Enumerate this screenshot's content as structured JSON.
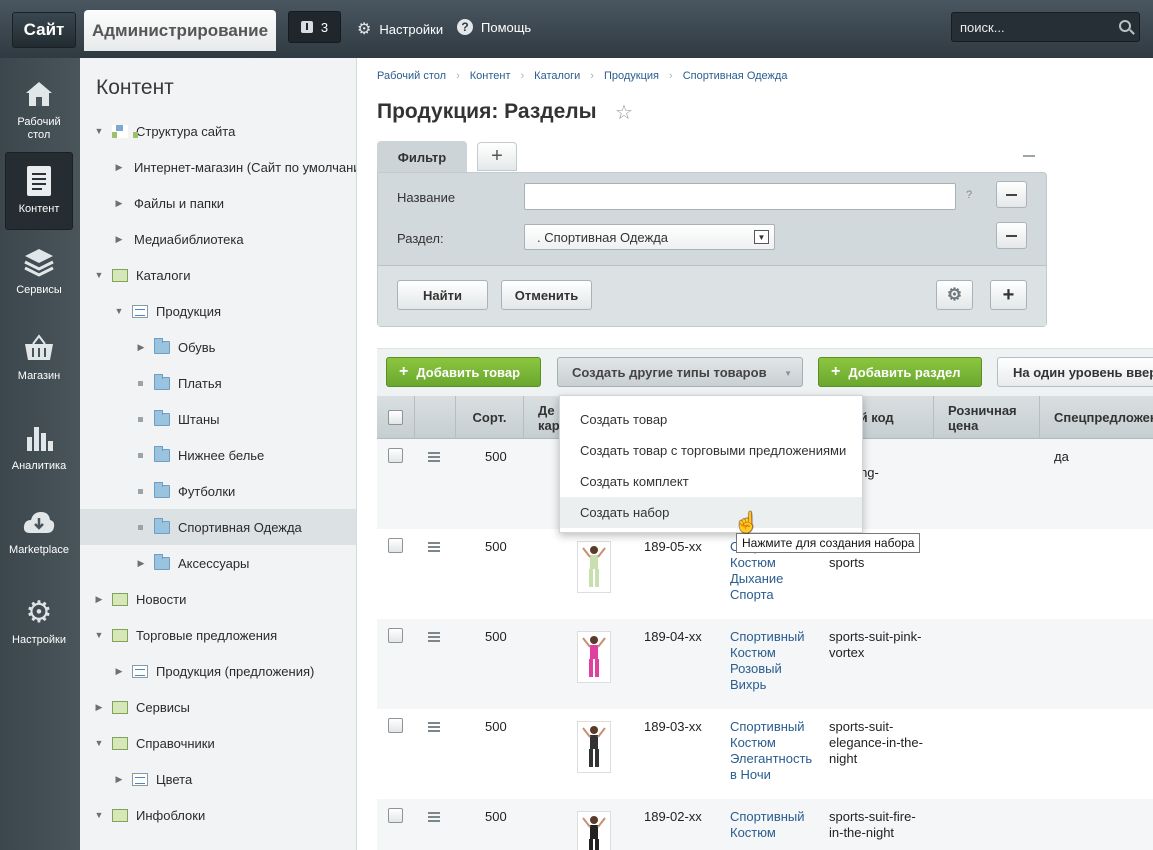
{
  "topbar": {
    "site": "Сайт",
    "admin": "Администрирование",
    "notifications": "3",
    "settings": "Настройки",
    "help": "Помощь",
    "search_placeholder": "поиск..."
  },
  "leftmenu": [
    {
      "label": "Рабочий стол",
      "icon": "home-icon"
    },
    {
      "label": "Контент",
      "icon": "document-icon",
      "active": true
    },
    {
      "label": "Сервисы",
      "icon": "layers-icon"
    },
    {
      "label": "Магазин",
      "icon": "basket-icon"
    },
    {
      "label": "Аналитика",
      "icon": "chart-icon"
    },
    {
      "label": "Marketplace",
      "icon": "cloud-download-icon"
    },
    {
      "label": "Настройки",
      "icon": "gear-icon"
    }
  ],
  "tree": {
    "title": "Контент",
    "items": [
      {
        "label": "Структура сайта",
        "level": 0,
        "expanded": true,
        "icon": "site-structure-icon"
      },
      {
        "label": "Интернет-магазин (Сайт по умолчанию)",
        "level": 1,
        "expanded": false,
        "icon": ""
      },
      {
        "label": "Файлы и папки",
        "level": 1,
        "expanded": false,
        "icon": ""
      },
      {
        "label": "Медиабиблиотека",
        "level": 1,
        "expanded": false,
        "icon": ""
      },
      {
        "label": "Каталоги",
        "level": 0,
        "expanded": true,
        "icon": "catalog-icon"
      },
      {
        "label": "Продукция",
        "level": 1,
        "expanded": true,
        "icon": "list-icon"
      },
      {
        "label": "Обувь",
        "level": 2,
        "expanded": false,
        "icon": "folder-icon"
      },
      {
        "label": "Платья",
        "level": 2,
        "leaf": true,
        "icon": "folder-icon"
      },
      {
        "label": "Штаны",
        "level": 2,
        "leaf": true,
        "icon": "folder-icon"
      },
      {
        "label": "Нижнее белье",
        "level": 2,
        "leaf": true,
        "icon": "folder-icon"
      },
      {
        "label": "Футболки",
        "level": 2,
        "leaf": true,
        "icon": "folder-icon"
      },
      {
        "label": "Спортивная Одежда",
        "level": 2,
        "leaf": true,
        "icon": "folder-icon",
        "selected": true
      },
      {
        "label": "Аксессуары",
        "level": 2,
        "expanded": false,
        "icon": "folder-icon"
      },
      {
        "label": "Новости",
        "level": 0,
        "expanded": false,
        "icon": "catalog-icon"
      },
      {
        "label": "Торговые предложения",
        "level": 0,
        "expanded": true,
        "icon": "catalog-icon"
      },
      {
        "label": "Продукция (предложения)",
        "level": 1,
        "expanded": false,
        "icon": "list-icon"
      },
      {
        "label": "Сервисы",
        "level": 0,
        "expanded": false,
        "icon": "catalog-icon"
      },
      {
        "label": "Справочники",
        "level": 0,
        "expanded": true,
        "icon": "catalog-icon"
      },
      {
        "label": "Цвета",
        "level": 1,
        "expanded": false,
        "icon": "list-icon"
      },
      {
        "label": "Инфоблоки",
        "level": 0,
        "expanded": true,
        "icon": "catalog-icon"
      }
    ]
  },
  "breadcrumbs": [
    "Рабочий стол",
    "Контент",
    "Каталоги",
    "Продукция",
    "Спортивная Одежда"
  ],
  "page_title": "Продукция: Разделы",
  "filter": {
    "tab": "Фильтр",
    "name_label": "Название",
    "name_value": "",
    "section_label": "Раздел:",
    "section_value": ". Спортивная Одежда",
    "help": "?",
    "find": "Найти",
    "cancel": "Отменить"
  },
  "toolbar": {
    "add_product": "Добавить товар",
    "create_other": "Создать другие типы товаров",
    "add_section": "Добавить раздел",
    "level_up": "На один уровень вверх"
  },
  "grid": {
    "columns": [
      "Сорт.",
      "Де\nкар",
      "",
      "Символьный код",
      "Розничная цена",
      "Спецпредложение"
    ],
    "rows": [
      {
        "sort": "500",
        "code": "",
        "name": "",
        "symbol": "-\nevening-\nes",
        "price": "",
        "special": "да"
      },
      {
        "sort": "500",
        "code": "189-05-xx",
        "name": "Спортивный Костюм Дыхание Спорта",
        "symbol": "suit-breath-sports",
        "price": "",
        "special": ""
      },
      {
        "sort": "500",
        "code": "189-04-xx",
        "name": "Спортивный Костюм Розовый Вихрь",
        "symbol": "sports-suit-pink-vortex",
        "price": "",
        "special": ""
      },
      {
        "sort": "500",
        "code": "189-03-xx",
        "name": "Спортивный Костюм Элегантность в Ночи",
        "symbol": "sports-suit-elegance-in-the-night",
        "price": "",
        "special": ""
      },
      {
        "sort": "500",
        "code": "189-02-xx",
        "name": "Спортивный Костюм",
        "symbol": "sports-suit-fire-in-the-night",
        "price": "",
        "special": ""
      }
    ]
  },
  "dropdown": {
    "items": [
      "Создать товар",
      "Создать товар с торговыми предложениями",
      "Создать комплект",
      "Создать набор"
    ],
    "tooltip": "Нажмите для создания набора"
  }
}
